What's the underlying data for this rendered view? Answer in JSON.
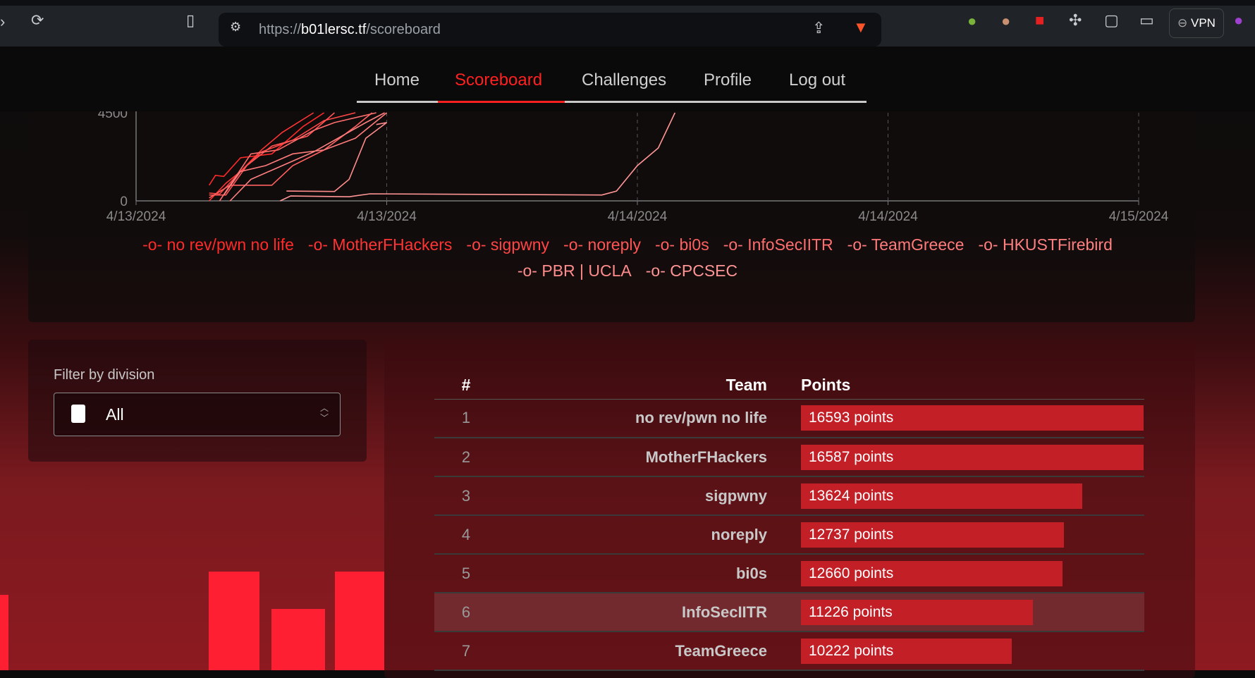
{
  "browser": {
    "url_prefix": "https://",
    "url_host": "b01lersc.tf",
    "url_path": "/scoreboard",
    "vpn_label": "VPN"
  },
  "nav": {
    "items": [
      {
        "label": "Home"
      },
      {
        "label": "Scoreboard",
        "active": true
      },
      {
        "label": "Challenges"
      },
      {
        "label": "Profile"
      },
      {
        "label": "Log out"
      }
    ]
  },
  "colors": {
    "accent": "#ff2020",
    "bar": "#c21f27"
  },
  "chart_data": {
    "type": "line",
    "y_ticks": [
      "0",
      "4500"
    ],
    "ylim": [
      0,
      4500
    ],
    "x_ticks": [
      "4/13/2024",
      "4/13/2024",
      "4/14/2024",
      "4/14/2024",
      "4/15/2024"
    ],
    "x_unit": "hours",
    "xlim": [
      0,
      48
    ],
    "grid": "vertical dashed",
    "legend": [
      "no rev/pwn no life",
      "MotherFHackers",
      "sigpwny",
      "noreply",
      "bi0s",
      "InfoSecIITR",
      "TeamGreece",
      "HKUSTFirebird",
      "PBR | UCLA",
      "CPCSEC"
    ],
    "legend_colors": [
      "#ff2a2a",
      "#ff3434",
      "#ff4545",
      "#ff5555",
      "#ff6060",
      "#ff6e6e",
      "#ff7b7b",
      "#ff8080",
      "#ff8c8c",
      "#ff9595"
    ],
    "series": [
      [
        [
          3.5,
          800
        ],
        [
          3.8,
          1300
        ],
        [
          4.2,
          1250
        ],
        [
          5,
          2200
        ],
        [
          6.5,
          2400
        ],
        [
          8,
          3800
        ],
        [
          9,
          4500
        ]
      ],
      [
        [
          3.5,
          0
        ],
        [
          4.3,
          900
        ],
        [
          5,
          1500
        ],
        [
          6,
          2600
        ],
        [
          7,
          3500
        ],
        [
          8.5,
          4500
        ]
      ],
      [
        [
          3.5,
          400
        ],
        [
          4,
          350
        ],
        [
          5,
          1500
        ],
        [
          6,
          2500
        ],
        [
          7.5,
          3100
        ],
        [
          9,
          4100
        ],
        [
          10.5,
          4500
        ]
      ],
      [
        [
          3.5,
          300
        ],
        [
          4.3,
          300
        ],
        [
          5.3,
          1800
        ],
        [
          6.5,
          2800
        ],
        [
          8.2,
          3300
        ],
        [
          9.5,
          4500
        ]
      ],
      [
        [
          3.5,
          150
        ],
        [
          4.5,
          800
        ],
        [
          6.5,
          800
        ],
        [
          7.5,
          1800
        ],
        [
          9,
          2600
        ],
        [
          10.5,
          3800
        ],
        [
          11.3,
          4500
        ]
      ],
      [
        [
          4,
          0
        ],
        [
          5.5,
          2400
        ],
        [
          6.8,
          2600
        ],
        [
          8.5,
          3600
        ],
        [
          9.5,
          4000
        ],
        [
          11.5,
          4500
        ]
      ],
      [
        [
          4.2,
          300
        ],
        [
          5,
          1500
        ],
        [
          6.2,
          1800
        ],
        [
          7.5,
          2400
        ],
        [
          9,
          2600
        ],
        [
          10.5,
          3200
        ],
        [
          12,
          4500
        ]
      ],
      [
        [
          4.5,
          0
        ],
        [
          5.5,
          1100
        ],
        [
          7,
          1800
        ],
        [
          8.5,
          2500
        ],
        [
          10,
          3400
        ],
        [
          11,
          4000
        ],
        [
          11.9,
          4500
        ]
      ],
      [
        [
          7.2,
          500
        ],
        [
          9.5,
          480
        ],
        [
          10.2,
          1100
        ],
        [
          11,
          3200
        ],
        [
          12,
          4000
        ],
        [
          11.5,
          3900
        ]
      ],
      [
        [
          6.9,
          0
        ],
        [
          7.4,
          250
        ],
        [
          10.2,
          210
        ],
        [
          11.2,
          360
        ],
        [
          22.3,
          300
        ],
        [
          23,
          500
        ],
        [
          24,
          1800
        ],
        [
          25,
          2700
        ],
        [
          25.8,
          4500
        ]
      ]
    ]
  },
  "filter": {
    "label": "Filter by division",
    "value": "All"
  },
  "table": {
    "headers": {
      "rank": "#",
      "team": "Team",
      "points": "Points"
    },
    "rows": [
      {
        "rank": "1",
        "team": "no rev/pwn no life",
        "points": 16593,
        "points_label": "16593 points"
      },
      {
        "rank": "2",
        "team": "MotherFHackers",
        "points": 16587,
        "points_label": "16587 points"
      },
      {
        "rank": "3",
        "team": "sigpwny",
        "points": 13624,
        "points_label": "13624 points"
      },
      {
        "rank": "4",
        "team": "noreply",
        "points": 12737,
        "points_label": "12737 points"
      },
      {
        "rank": "5",
        "team": "bi0s",
        "points": 12660,
        "points_label": "12660 points"
      },
      {
        "rank": "6",
        "team": "InfoSecIITR",
        "points": 11226,
        "points_label": "11226 points",
        "highlighted": true
      },
      {
        "rank": "7",
        "team": "TeamGreece",
        "points": 10222,
        "points_label": "10222 points"
      }
    ]
  }
}
